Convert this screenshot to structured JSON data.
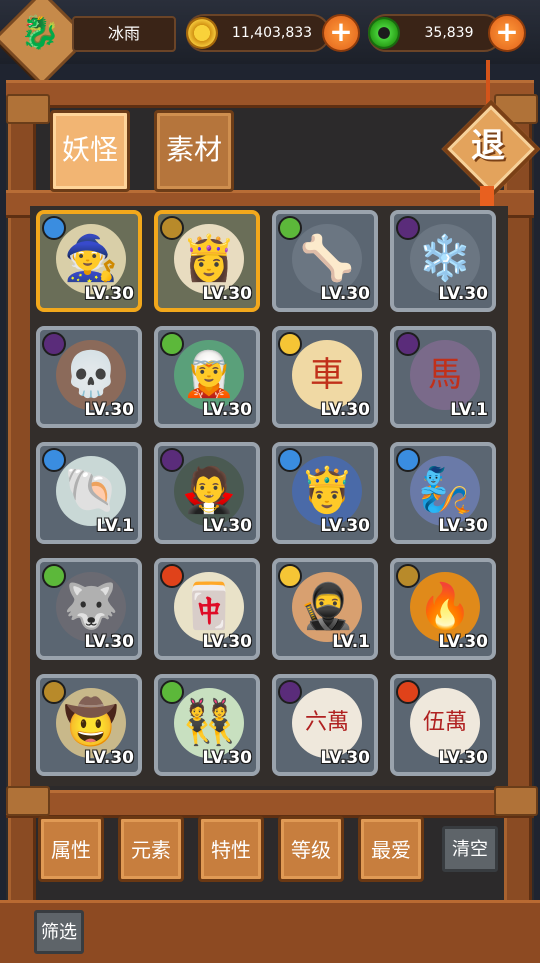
{
  "player": {
    "name": "冰雨",
    "avatar_icon": "🐉"
  },
  "resources": {
    "gold": {
      "value": "11,403,833",
      "icon": "gold-coin-icon"
    },
    "jade": {
      "value": "35,839",
      "icon": "jade-coin-icon"
    }
  },
  "tabs": [
    {
      "label": "妖怪",
      "active": true
    },
    {
      "label": "素材",
      "active": false
    }
  ],
  "exit_label": "退",
  "cards": [
    {
      "art": "🧙",
      "element": "water",
      "level": "LV.30",
      "highlight": true,
      "bg": "#d9cfa8"
    },
    {
      "art": "👸",
      "element": "earth",
      "level": "LV.30",
      "highlight": true,
      "bg": "#e8dcc0"
    },
    {
      "art": "🦴",
      "element": "wood",
      "level": "LV.30",
      "highlight": false,
      "bg": "#6b7682"
    },
    {
      "art": "❄️",
      "element": "dark",
      "level": "LV.30",
      "highlight": false,
      "bg": "#6b7682"
    },
    {
      "art": "💀",
      "element": "dark",
      "level": "LV.30",
      "highlight": false,
      "bg": "#8b6a5a"
    },
    {
      "art": "🧝",
      "element": "wood",
      "level": "LV.30",
      "highlight": false,
      "bg": "#5aa07a"
    },
    {
      "art": "車",
      "element": "light",
      "level": "LV.30",
      "highlight": false,
      "bg": "#f0d9a4"
    },
    {
      "art": "馬",
      "element": "dark",
      "level": "LV.1",
      "highlight": false,
      "bg": "#7a6a8a"
    },
    {
      "art": "🐚",
      "element": "water",
      "level": "LV.1",
      "highlight": false,
      "bg": "#c9d8d6"
    },
    {
      "art": "🧛",
      "element": "dark",
      "level": "LV.30",
      "highlight": false,
      "bg": "#4a5a52"
    },
    {
      "art": "🤴",
      "element": "water",
      "level": "LV.30",
      "highlight": false,
      "bg": "#4a6aa8"
    },
    {
      "art": "🧞",
      "element": "water",
      "level": "LV.30",
      "highlight": false,
      "bg": "#6a7aa8"
    },
    {
      "art": "🐺",
      "element": "wood",
      "level": "LV.30",
      "highlight": false,
      "bg": "#6a6a72"
    },
    {
      "art": "🀄",
      "element": "fire",
      "level": "LV.30",
      "highlight": false,
      "bg": "#e9e2c8"
    },
    {
      "art": "🥷",
      "element": "light",
      "level": "LV.1",
      "highlight": false,
      "bg": "#d8a070"
    },
    {
      "art": "🔥",
      "element": "earth",
      "level": "LV.30",
      "highlight": false,
      "bg": "#e08a1a"
    },
    {
      "art": "🤠",
      "element": "earth",
      "level": "LV.30",
      "highlight": false,
      "bg": "#c8b88a"
    },
    {
      "art": "👯",
      "element": "wood",
      "level": "LV.30",
      "highlight": false,
      "bg": "#c8e0c0"
    },
    {
      "art": "六萬",
      "element": "dark",
      "level": "LV.30",
      "highlight": false,
      "bg": "#efe8dc"
    },
    {
      "art": "伍萬",
      "element": "fire",
      "level": "LV.30",
      "highlight": false,
      "bg": "#efe8dc"
    }
  ],
  "filters": [
    "属性",
    "元素",
    "特性",
    "等级",
    "最爱"
  ],
  "clear_label": "清空",
  "screen_label": "筛选"
}
